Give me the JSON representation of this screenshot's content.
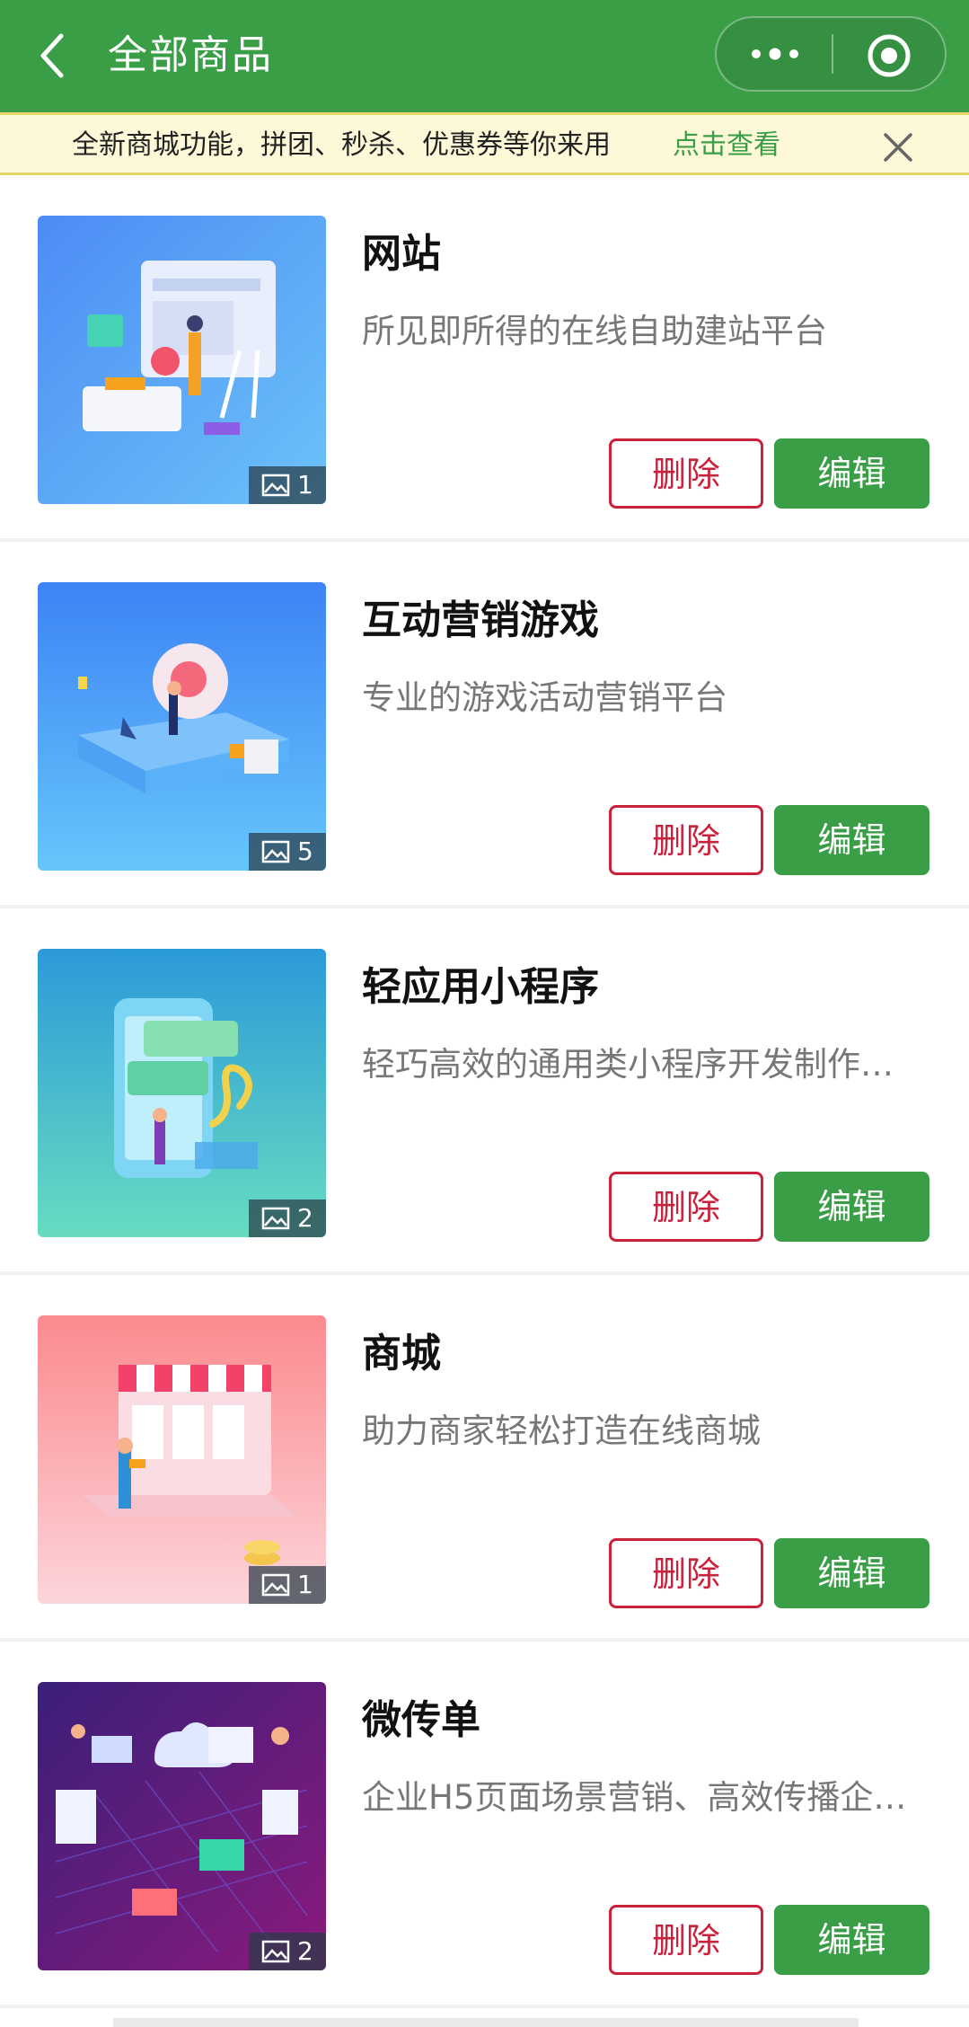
{
  "nav": {
    "title": "全部商品"
  },
  "notice": {
    "text": "全新商城功能，拼团、秒杀、优惠券等你来用",
    "link": "点击查看"
  },
  "buttons": {
    "delete": "删除",
    "edit": "编辑"
  },
  "products": [
    {
      "name": "网站",
      "desc": "所见即所得的在线自助建站平台",
      "image_count": "1"
    },
    {
      "name": "互动营销游戏",
      "desc": "专业的游戏活动营销平台",
      "image_count": "5"
    },
    {
      "name": "轻应用小程序",
      "desc": "轻巧高效的通用类小程序开发制作…",
      "image_count": "2"
    },
    {
      "name": "商城",
      "desc": "助力商家轻松打造在线商城",
      "image_count": "1"
    },
    {
      "name": "微传单",
      "desc": "企业H5页面场景营销、高效传播企…",
      "image_count": "2"
    }
  ],
  "colors": {
    "brand_green": "#3a9e47",
    "delete_red": "#c8223d",
    "notice_bg": "#fdf8d8"
  }
}
